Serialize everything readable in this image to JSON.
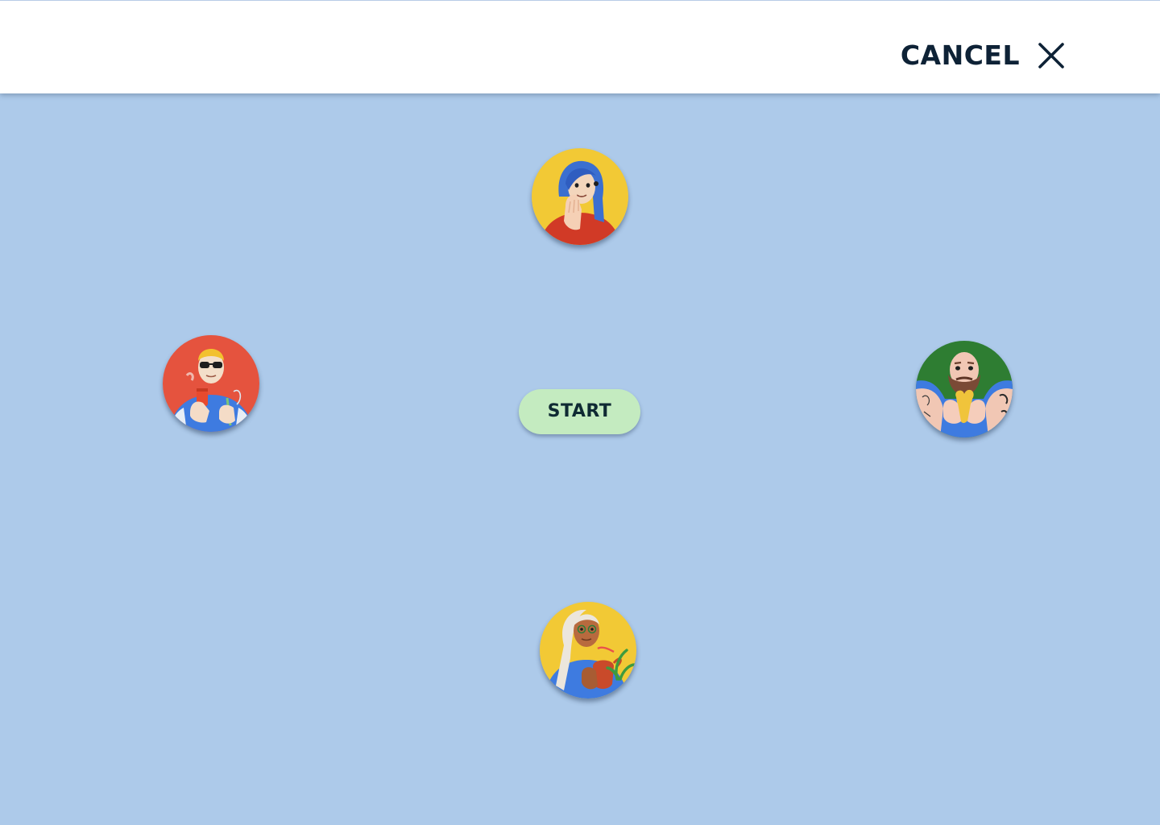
{
  "header": {
    "cancel_label": "CANCEL",
    "cancel_icon": "close-icon"
  },
  "main": {
    "start_label": "START",
    "avatars": [
      {
        "id": "top",
        "background": "#F2C935",
        "description_icon": "avatar-blue-hair-woman"
      },
      {
        "id": "left",
        "background": "#E5533E",
        "description_icon": "avatar-sunglasses-man"
      },
      {
        "id": "right",
        "background": "#2E7D32",
        "description_icon": "avatar-bearded-man"
      },
      {
        "id": "bottom",
        "background": "#F2C935",
        "description_icon": "avatar-woman-with-plant"
      }
    ]
  },
  "colors": {
    "page_background": "#ADCAEA",
    "header_background": "#FFFFFF",
    "start_button": "#C4EBC0",
    "text_dark": "#0E2236"
  }
}
